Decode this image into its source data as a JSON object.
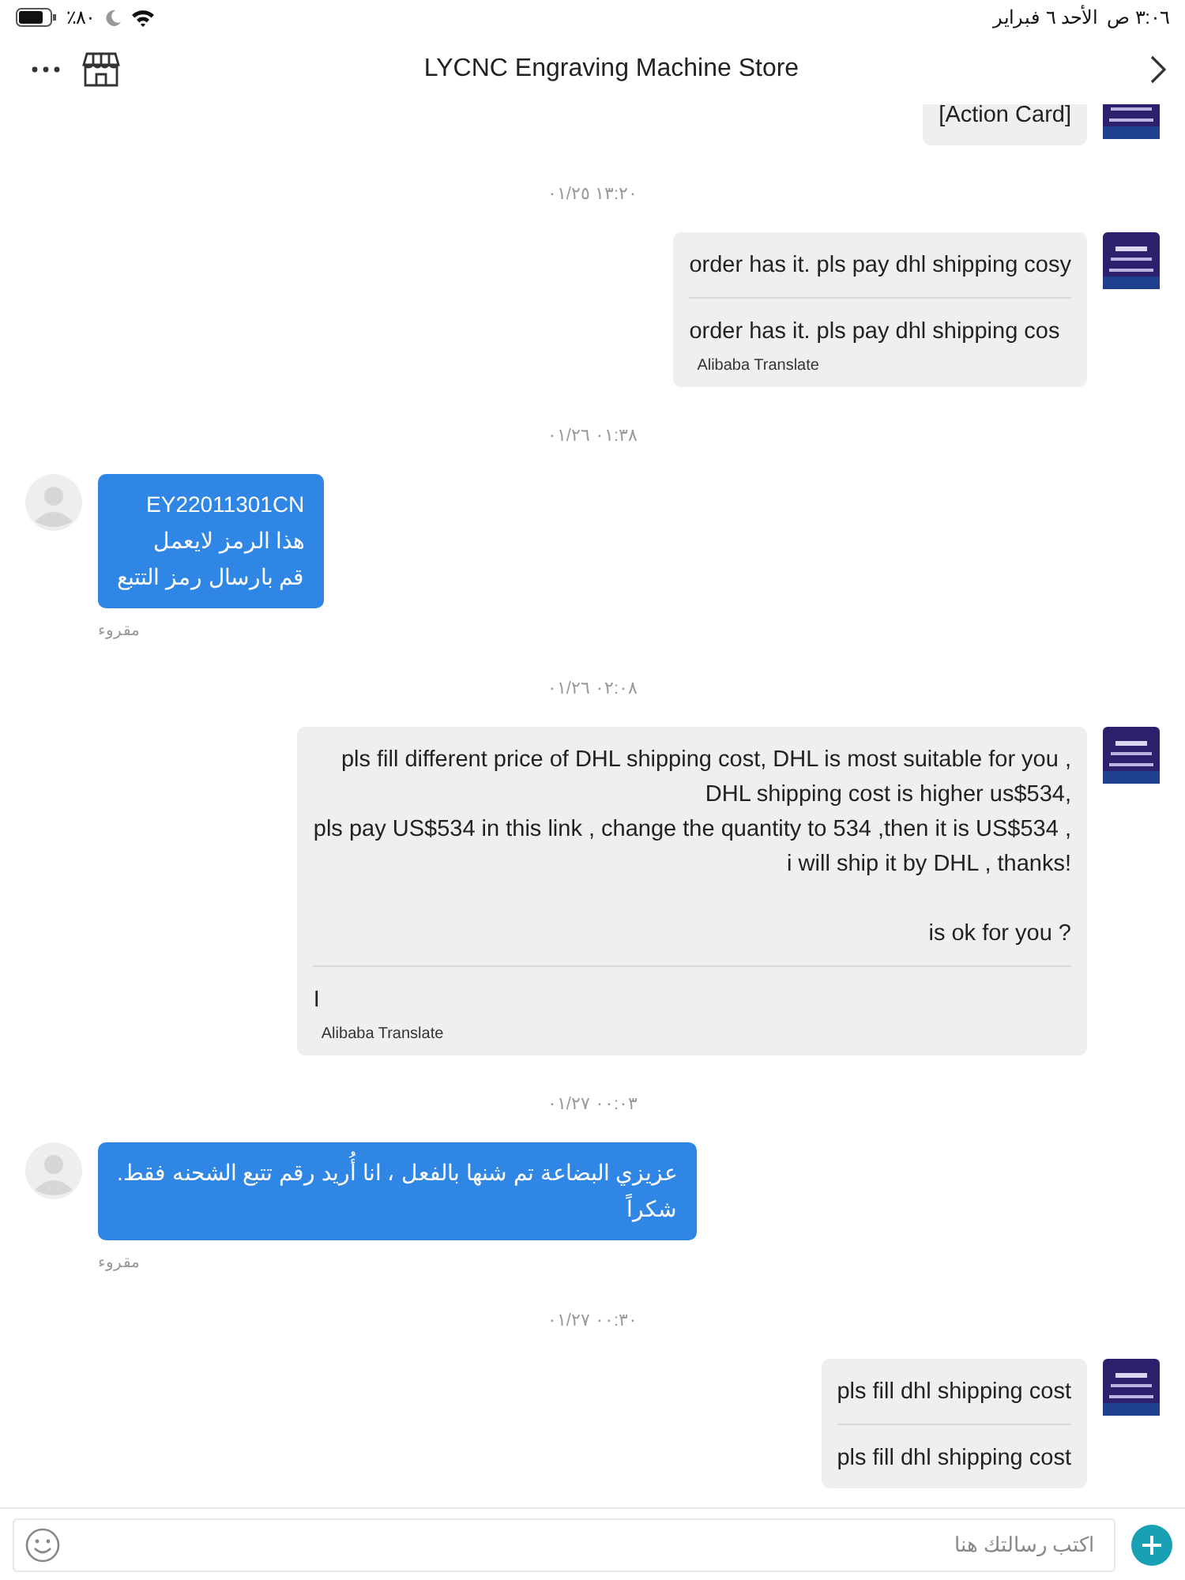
{
  "status_bar": {
    "time": "٣:٠٦ ص",
    "date": "الأحد ٦ فبراير",
    "battery": "٪٨٠"
  },
  "header": {
    "title": "LYCNC Engraving Machine Store"
  },
  "messages": [
    {
      "kind": "seller",
      "text": "[Action Card]"
    },
    {
      "kind": "time",
      "text": "١٣:٢٠ ٠١/٢٥"
    },
    {
      "kind": "seller",
      "text": "order has it.  pls pay dhl shipping cosy",
      "translation": "order has it. pls pay dhl shipping cos",
      "translator": "Alibaba Translate"
    },
    {
      "kind": "time",
      "text": "٠١:٣٨ ٠١/٢٦"
    },
    {
      "kind": "buyer",
      "text": "EY22011301CN\nهذا الرمز لايعمل\nقم بارسال رمز التتبع",
      "status": "مقروء"
    },
    {
      "kind": "time",
      "text": "٠٢:٠٨ ٠١/٢٦"
    },
    {
      "kind": "seller",
      "text": "pls fill different price of DHL shipping cost,  DHL is most suitable for you ,\nDHL shipping cost is higher us$534,\npls pay US$534 in this link , change the quantity to 534 ,then it is US$534 ,\ni will ship it by DHL , thanks!\n\nis ok for you ?",
      "translation": "I",
      "translator": "Alibaba Translate"
    },
    {
      "kind": "time",
      "text": "٠٠:٠٣ ٠١/٢٧"
    },
    {
      "kind": "buyer",
      "text": "عزيزي البضاعة تم شنها بالفعل ، انا أُريد رقم تتبع الشحنه فقط.\nشكراً",
      "status": "مقروء"
    },
    {
      "kind": "time",
      "text": "٠٠:٣٠ ٠١/٢٧"
    },
    {
      "kind": "seller",
      "text": "pls fill dhl shipping cost",
      "translation": "pls fill dhl shipping cost"
    }
  ],
  "composer": {
    "placeholder": "اكتب رسالتك هنا"
  }
}
